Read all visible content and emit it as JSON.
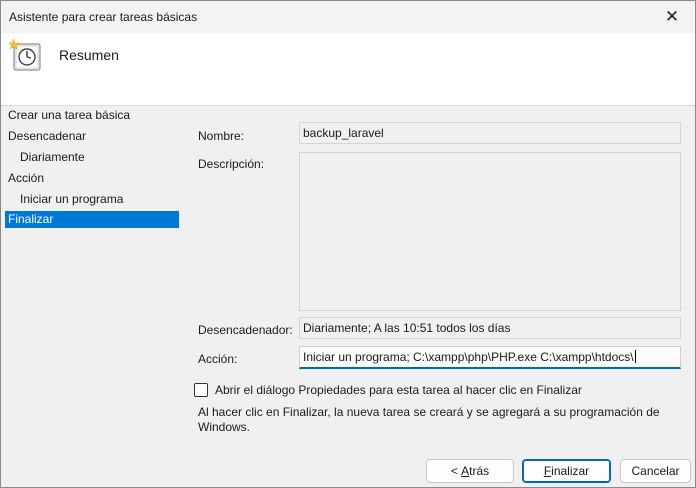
{
  "window": {
    "title": "Asistente para crear tareas básicas",
    "close_glyph": "✕"
  },
  "header": {
    "title": "Resumen",
    "icon": "task-clock-icon"
  },
  "nav": {
    "items": [
      {
        "label": "Crear una tarea básica",
        "indent": false,
        "active": false
      },
      {
        "label": "Desencadenar",
        "indent": false,
        "active": false
      },
      {
        "label": "Diariamente",
        "indent": true,
        "active": false
      },
      {
        "label": "Acción",
        "indent": false,
        "active": false
      },
      {
        "label": "Iniciar un programa",
        "indent": true,
        "active": false
      },
      {
        "label": "Finalizar",
        "indent": false,
        "active": true
      }
    ]
  },
  "summary": {
    "name_label": "Nombre:",
    "name_value": "backup_laravel",
    "description_label": "Descripción:",
    "description_value": "",
    "trigger_label": "Desencadenador:",
    "trigger_value": "Diariamente; A las 10:51 todos los días",
    "action_label": "Acción:",
    "action_value": "Iniciar un programa; C:\\xampp\\php\\PHP.exe C:\\xampp\\htdocs\\"
  },
  "options": {
    "open_properties_label": "Abrir el diálogo Propiedades para esta tarea al hacer clic en Finalizar",
    "open_properties_checked": false,
    "info_text": "Al hacer clic en Finalizar, la nueva tarea se creará y se agregará a su programación de Windows."
  },
  "buttons": {
    "back_prefix": "< ",
    "back_accel": "A",
    "back_rest": "trás",
    "finish_accel": "F",
    "finish_rest": "inalizar",
    "cancel_label": "Cancelar"
  },
  "colors": {
    "accent": "#0078d7",
    "focus": "#0067c0"
  }
}
